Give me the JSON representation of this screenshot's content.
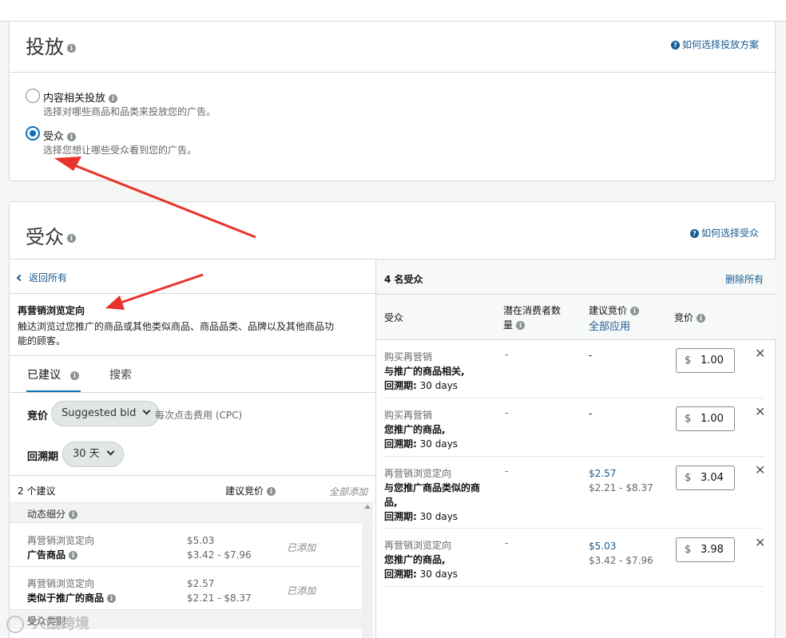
{
  "delivery": {
    "title": "投放",
    "help": "如何选择投放方案",
    "options": [
      {
        "label": "内容相关投放",
        "desc": "选择对哪些商品和品类来投放您的广告。",
        "selected": false
      },
      {
        "label": "受众",
        "desc": "选择您想让哪些受众看到您的广告。",
        "selected": true
      }
    ]
  },
  "audience": {
    "title": "受众",
    "help": "如何选择受众",
    "back": "返回所有",
    "heading": "再营销浏览定向",
    "description_line1": "触达浏览过您推广的商品或其他类似商品、商品品类、品牌以及其他商品功",
    "description_line2": "能的顾客。",
    "tabs": [
      "已建议",
      "搜索"
    ],
    "bid_label": "竞价",
    "bid_select": "Suggested bid",
    "bid_note": "每次点击费用 (CPC)",
    "lookback_label": "回溯期",
    "lookback_select": "30 天",
    "suggest_count": "2 个建议",
    "suggest_bid_header": "建议竞价",
    "add_all": "全部添加",
    "group1": "动态细分",
    "group2": "受众类别",
    "suggestions": [
      {
        "category": "再营销浏览定向",
        "name": "广告商品",
        "bid": "$5.03",
        "range": "$3.42 - $7.96",
        "status": "已添加"
      },
      {
        "category": "再营销浏览定向",
        "name": "类似于推广的商品",
        "bid": "$2.57",
        "range": "$2.21 - $8.37",
        "status": "已添加"
      }
    ],
    "right": {
      "count_title": "4 名受众",
      "remove_all": "删除所有",
      "col_audience": "受众",
      "col_potential_1": "潜在消费者数",
      "col_potential_2": "量",
      "col_suggest": "建议竞价",
      "apply_all": "全部应用",
      "col_bid": "竞价",
      "rows": [
        {
          "category": "购买再营销",
          "line1": "与推广的商品相关,",
          "line2": "",
          "lookback_label": "回溯期:",
          "lookback": "30 days",
          "potential": "-",
          "suggest": "-",
          "range": "",
          "currency": "$",
          "bid": "1.00"
        },
        {
          "category": "购买再营销",
          "line1": "您推广的商品,",
          "line2": "",
          "lookback_label": "回溯期:",
          "lookback": "30 days",
          "potential": "-",
          "suggest": "-",
          "range": "",
          "currency": "$",
          "bid": "1.00"
        },
        {
          "category": "再营销浏览定向",
          "line1": "与您推广商品类似的商",
          "line2": "品,",
          "lookback_label": "回溯期:",
          "lookback": "30 days",
          "potential": "-",
          "suggest": "$2.57",
          "range": "$2.21 - $8.37",
          "currency": "$",
          "bid": "3.04"
        },
        {
          "category": "再营销浏览定向",
          "line1": "您推广的商品,",
          "line2": "",
          "lookback_label": "回溯期:",
          "lookback": "30 days",
          "potential": "-",
          "suggest": "$5.03",
          "range": "$3.42 - $7.96",
          "currency": "$",
          "bid": "3.98"
        }
      ]
    }
  },
  "watermark": "人战跨境"
}
